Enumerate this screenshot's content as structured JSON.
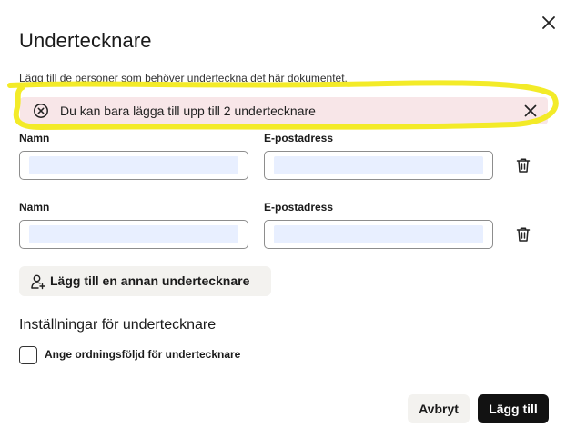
{
  "dialog": {
    "title": "Undertecknare",
    "subtitle": "Lägg till de personer som behöver underteckna det här dokumentet.",
    "close_icon": "close-icon"
  },
  "alert": {
    "text": "Du kan bara lägga till upp till 2 undertecknare",
    "icon": "error-circle-icon",
    "close_icon": "close-icon"
  },
  "signers": [
    {
      "name_label": "Namn",
      "email_label": "E-postadress",
      "name_value": "",
      "email_value": "",
      "delete_icon": "trash-icon"
    },
    {
      "name_label": "Namn",
      "email_label": "E-postadress",
      "name_value": "",
      "email_value": "",
      "delete_icon": "trash-icon"
    }
  ],
  "add_signer": {
    "label": "Lägg till en annan undertecknare",
    "icon": "add-user-icon"
  },
  "settings": {
    "title": "Inställningar för undertecknare",
    "order_checkbox_label": "Ange ordningsföljd för undertecknare",
    "order_checked": false
  },
  "footer": {
    "cancel_label": "Avbryt",
    "submit_label": "Lägg till"
  },
  "colors": {
    "alert_bg": "#f8e6e8",
    "highlight": "#f2ea1c",
    "primary": "#121212",
    "secondary_bg": "#f3f2ef"
  }
}
